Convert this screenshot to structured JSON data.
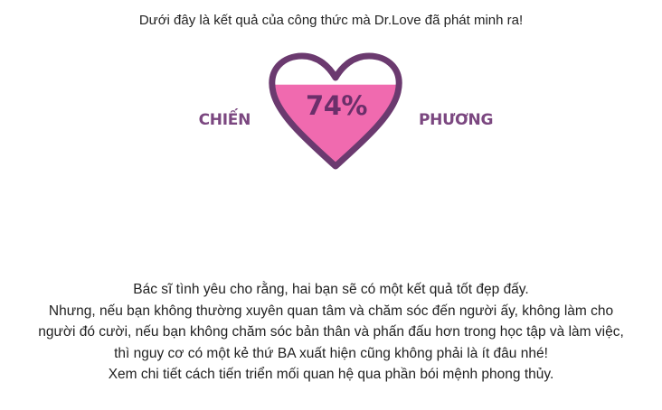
{
  "intro": "Dưới đây là kết quả của công thức mà Dr.Love đã phát minh ra!",
  "result": {
    "percent_label": "74%",
    "fill_fraction": 0.74,
    "name_left": "CHIẾN",
    "name_right": "PHƯƠNG",
    "colors": {
      "heart_outline": "#6b3a6f",
      "heart_fill": "#f06aaf",
      "name_text": "#7b4780",
      "percent_text": "#6b2f6a"
    },
    "icon": "heart-icon"
  },
  "message": {
    "lines": [
      "Bác sĩ tình yêu cho rằng, hai bạn sẽ có một kết quả tốt đẹp đấy.",
      "Nhưng, nếu bạn không thường xuyên quan tâm và chăm sóc đến người ấy, không làm cho",
      "người đó cười, nếu bạn không chăm sóc bản thân và phấn đấu hơn trong học tập và làm việc,",
      "thì nguy cơ có một kẻ thứ BA xuất hiện cũng không phải là ít đâu nhé!",
      "Xem chi tiết cách tiến triển mối quan hệ qua phần bói mệnh phong thủy."
    ]
  }
}
